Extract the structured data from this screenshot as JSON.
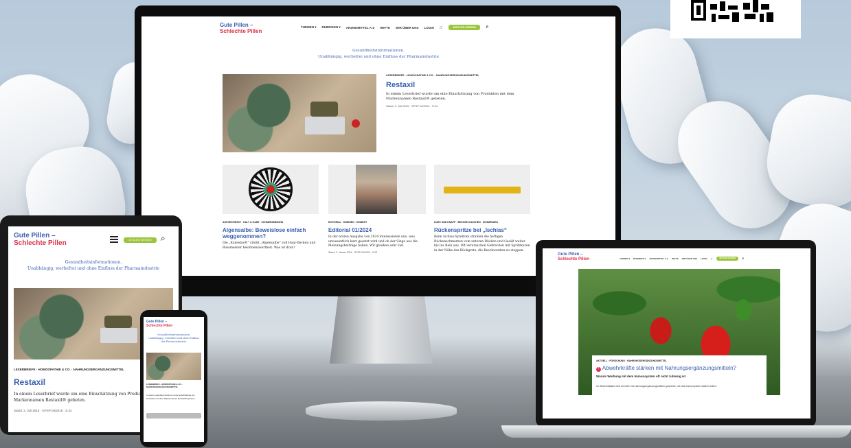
{
  "brand": {
    "line1": "Gute Pillen –",
    "line2": "Schlechte Pillen"
  },
  "nav": {
    "items": [
      "THEMEN ▾",
      "RUBRIKEN ▾",
      "ARZNEIMITTEL A-Z",
      "HEFTE",
      "WIR ÜBER UNS",
      "LOGIN"
    ],
    "green_button": "MITGLIED WERDEN"
  },
  "slogan": {
    "line1": "Gesundheitsinformationen.",
    "line2": "Unabhängig, werbefrei und ohne Einfluss der Pharmaindustrie"
  },
  "desktop": {
    "featured": {
      "tag": "LESERBRIEFE · HOMÖOPATHIE & CO. · NAHRUNGSERGÄNZUNGSMITTEL",
      "title": "Restaxil",
      "text": "In einem Leserbrief wurde um eine Einschätzung von Produkten mit dem Markennamen Restaxil® gebeten.",
      "meta": "Stand: 2. Juli 2019 · GPSP 04/2019 · S.24"
    },
    "cards": [
      {
        "tag": "AUFGESPIESST · HALT & HARZ · SCHMERZMEDIZIN",
        "title": "Algensalbe: Beweislose einfach weggenommen?",
        "text": "Die „Kawedas®“ stärkt „Algensalbe“ voll Haar-flecken und Rossmeister belohnenswertheit. Was ist dran?"
      },
      {
        "tag": "EDITORIAL · KRIENEN · KRINEDT",
        "title": "Editorial 01/2024",
        "text": "In der ersten Ausgabe von 2024 interessieren uns, was unwesentlich kurz gesetzt wird und ob der Singe aus die Meinungsbeiträge haben. Wir glauben sehr viel.",
        "meta": "Stand: 2. Januar 2024 · GPSP 01/2024 · S.23"
      },
      {
        "tag": "KURZ UND KNAPP · BELEGE KNOCHEN · SCHMERZEN",
        "title": "Rückenspritze bei „Ischias“",
        "text": "Beim Ischias-Syndrom strahlen die heftigen Rückenschmerzen vom unteren Rücken und Gesäß weiter bis ins Bein aus. Oft verursachen Gebrechen mit Spritzkuren in der Nähe des Rückgrats, die Beschwerden zu stoppen."
      }
    ]
  },
  "tablet": {
    "tag": "LESERBRIEFE · HOMÖOPATHIE & CO. · NAHRUNGSERGÄNZUNGSMITTEL",
    "title": "Restaxil",
    "text": "In einem Leserbrief wurde um eine Einschätzung von Produkten mit dem Markennamen Restaxil® gebeten.",
    "meta": "Stand: 2. Juli 2019 · GPSP 04/2019 · S.24"
  },
  "laptop": {
    "tag": "AKTUELL · FORSCHUNG · NAHRUNGSERGÄNZUNGSMITTEL",
    "title": "Abwehrkräfte stärken mit Nahrungsergänzungsmitteln?",
    "subtitle": "Warum Werbung mit dem Immunsystem oft nicht zulässig ist",
    "text": "Im Winterhalbjahr wird vermehrt mit Nahrungsergänzungsmitteln geworben, die das Immunsystem stärken sollen."
  },
  "colors": {
    "brand_blue": "#3a5fb0",
    "brand_red": "#d8334a",
    "accent_green": "#9bc53d"
  }
}
